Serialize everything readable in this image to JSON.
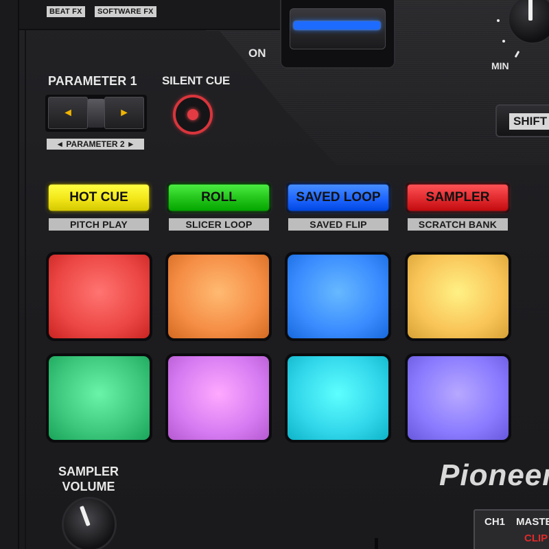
{
  "top_tags": [
    "BEAT FX",
    "SOFTWARE FX"
  ],
  "fader": {
    "label": "ON",
    "led_color": "#1e6bff"
  },
  "knob_top": {
    "label": "MIN"
  },
  "shift": {
    "label": "SHIFT"
  },
  "parameter": {
    "title": "PARAMETER 1",
    "sub_label": "◄ PARAMETER 2 ►",
    "left_glyph": "◄",
    "right_glyph": "►"
  },
  "silent_cue": {
    "label": "SILENT CUE",
    "color": "#d8353c"
  },
  "modes": [
    {
      "label": "HOT CUE",
      "sub": "PITCH PLAY",
      "color": "#f2e619"
    },
    {
      "label": "ROLL",
      "sub": "SLICER LOOP",
      "color": "#22c41a"
    },
    {
      "label": "SAVED LOOP",
      "sub": "SAVED FLIP",
      "color": "#1e66ff"
    },
    {
      "label": "SAMPLER",
      "sub": "SCRATCH BANK",
      "color": "#e02a2e"
    }
  ],
  "pads": [
    {
      "color": "#ec4744"
    },
    {
      "color": "#f58d45"
    },
    {
      "color": "#3a8cff"
    },
    {
      "color": "#f9c458"
    },
    {
      "color": "#3cc77c"
    },
    {
      "color": "#d77cf2"
    },
    {
      "color": "#31d6ea"
    },
    {
      "color": "#8a7bff"
    }
  ],
  "sampler_volume": {
    "label_line1": "SAMPLER",
    "label_line2": "VOLUME"
  },
  "brand": {
    "logo": "Pioneer"
  },
  "screen": {
    "channel": "CH1",
    "master": "MASTER",
    "clip": "CLIP"
  }
}
